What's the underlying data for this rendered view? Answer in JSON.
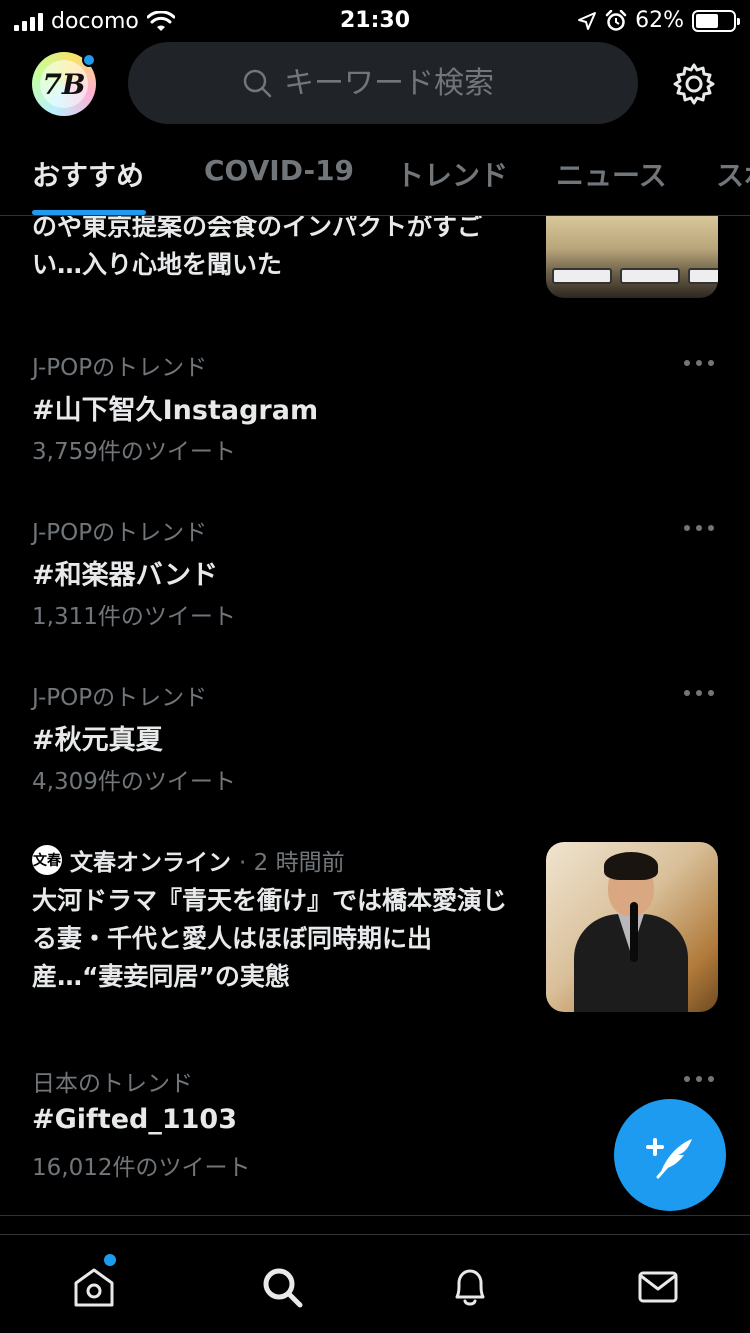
{
  "status_bar": {
    "carrier": "docomo",
    "time": "21:30",
    "battery_text": "62%",
    "battery_level": 0.62
  },
  "header": {
    "avatar_text": "7B",
    "search_placeholder": "キーワード検索",
    "icons": [
      "search-icon",
      "gear-icon"
    ]
  },
  "tabs": [
    {
      "label": "おすすめ",
      "active": true
    },
    {
      "label": "COVID-19",
      "active": false
    },
    {
      "label": "トレンド",
      "active": false
    },
    {
      "label": "ニュース",
      "active": false
    },
    {
      "label": "スポ",
      "active": false
    }
  ],
  "top_story": {
    "headline": "のや東京提案の会食のインパクトがすごい…入り心地を聞いた"
  },
  "trends": [
    {
      "category": "J-POPのトレンド",
      "name": "#山下智久Instagram",
      "count": "3,759件のツイート"
    },
    {
      "category": "J-POPのトレンド",
      "name": "#和楽器バンド",
      "count": "1,311件のツイート"
    },
    {
      "category": "J-POPのトレンド",
      "name": "#秋元真夏",
      "count": "4,309件のツイート"
    }
  ],
  "news": {
    "source_logo": "文春",
    "source": "文春オンライン",
    "time": "· 2 時間前",
    "headline": "大河ドラマ『青天を衝け』では橋本愛演じる妻・千代と愛人はほぼ同時期に出産…“妻妾同居”の実態"
  },
  "trend_last": {
    "category": "日本のトレンド",
    "name": "#Gifted_1103",
    "count": "16,012件のツイート"
  },
  "bottom_nav": [
    "home-icon",
    "search-icon",
    "bell-icon",
    "mail-icon"
  ],
  "colors": {
    "accent": "#1d9bf0",
    "background": "#000000",
    "secondary_text": "#71767b",
    "primary_text": "#e7e9ea"
  }
}
